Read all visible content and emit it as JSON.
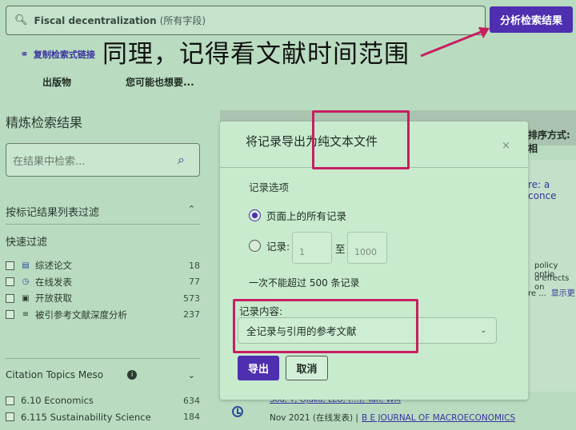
{
  "search": {
    "query": "Fiscal decentralization",
    "scope": "(所有字段)",
    "analyze_button": "分析检索结果",
    "copy_link": "复制检索式链接"
  },
  "annotation_text": "同理，记得看文献时间范围",
  "nav": {
    "publications": "出版物",
    "you_may_want": "您可能也想要..."
  },
  "sidebar": {
    "title": "精炼检索结果",
    "refine_placeholder": "在结果中检索...",
    "filter_heading": "按标记结果列表过滤",
    "quick_filter": "快速过滤",
    "quick_items": [
      {
        "label": "综述论文",
        "count": "18",
        "icon": "document-icon"
      },
      {
        "label": "在线发表",
        "count": "77",
        "icon": "clock-icon"
      },
      {
        "label": "开放获取",
        "count": "573",
        "icon": "lock-icon"
      },
      {
        "label": "被引参考文献深度分析",
        "count": "237",
        "icon": "list-icon"
      }
    ],
    "topics_heading": "Citation Topics Meso",
    "topics": [
      {
        "label": "6.10 Economics",
        "count": "634"
      },
      {
        "label": "6.115 Sustainability Science",
        "count": "184"
      }
    ]
  },
  "results": {
    "sort_label": "排序方式: 相",
    "peek_title": "re: a conce",
    "peek_line1": "policy optio",
    "peek_line2": "d effects on",
    "peek_line3": "re ...",
    "peek_more": "显示更",
    "peek_authors": "Sou, T; Ojuku, LLO; (...); Yan, WM",
    "date": "Nov 2021 (在线发表) |",
    "journal": "B E JOURNAL OF MACROECONOMICS"
  },
  "modal": {
    "title": "将记录导出为纯文本文件",
    "close": "×",
    "record_options": "记录选项",
    "option_all": "页面上的所有记录",
    "option_range": "记录:",
    "range_from_placeholder": "1",
    "range_sep": "至",
    "range_to_placeholder": "1000",
    "limit_note": "一次不能超过 500 条记录",
    "content_label": "记录内容:",
    "content_value": "全记录与引用的参考文献",
    "export_button": "导出",
    "cancel_button": "取消"
  },
  "colors": {
    "accent": "#4d2fb0",
    "highlight": "#c81e61",
    "background": "#b9dcc0"
  }
}
